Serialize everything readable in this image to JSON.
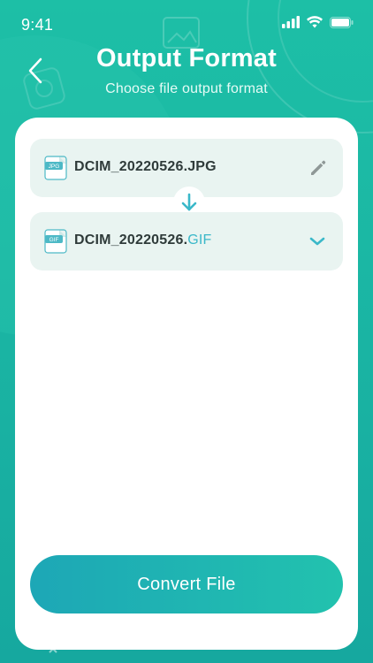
{
  "status_bar": {
    "time": "9:41",
    "signal_icon": "cellular-signal-icon",
    "wifi_icon": "wifi-icon",
    "battery_icon": "battery-icon"
  },
  "header": {
    "title": "Output Format",
    "subtitle": "Choose file output format",
    "back_icon": "chevron-left-icon"
  },
  "source_file": {
    "name": "DCIM_20220526.JPG",
    "badge": "JPG",
    "action_icon": "pencil-edit-icon"
  },
  "conversion_arrow_icon": "arrow-down-icon",
  "output_file": {
    "base_name": "DCIM_20220526.",
    "extension": "GIF",
    "badge": "GIF",
    "action_icon": "chevron-down-icon"
  },
  "actions": {
    "convert_label": "Convert File"
  },
  "colors": {
    "background": "#1bb7a4",
    "accent": "#3ab8c9",
    "row_background": "#e9f4f1",
    "button_start": "#1da7b6",
    "button_end": "#22c2ae"
  }
}
